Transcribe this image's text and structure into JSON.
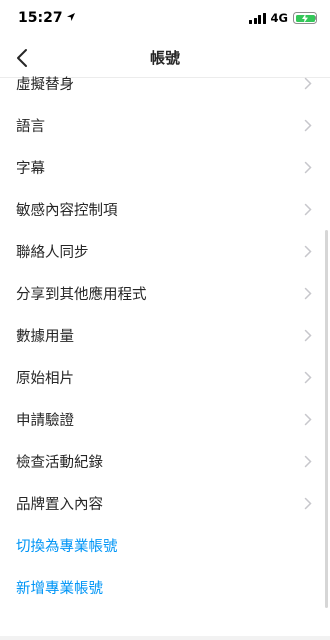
{
  "status": {
    "time": "15:27",
    "network": "4G",
    "battery_color": "#34c759"
  },
  "nav": {
    "title": "帳號"
  },
  "items": [
    {
      "label": "虛擬替身"
    },
    {
      "label": "語言"
    },
    {
      "label": "字幕"
    },
    {
      "label": "敏感內容控制項"
    },
    {
      "label": "聯絡人同步"
    },
    {
      "label": "分享到其他應用程式"
    },
    {
      "label": "數據用量"
    },
    {
      "label": "原始相片"
    },
    {
      "label": "申請驗證"
    },
    {
      "label": "檢查活動紀錄"
    },
    {
      "label": "品牌置入內容"
    }
  ],
  "actions": {
    "switch_pro": "切換為專業帳號",
    "add_pro": "新增專業帳號"
  },
  "colors": {
    "link": "#0095f6",
    "text": "#262626",
    "chevron": "#c7c7cc"
  }
}
